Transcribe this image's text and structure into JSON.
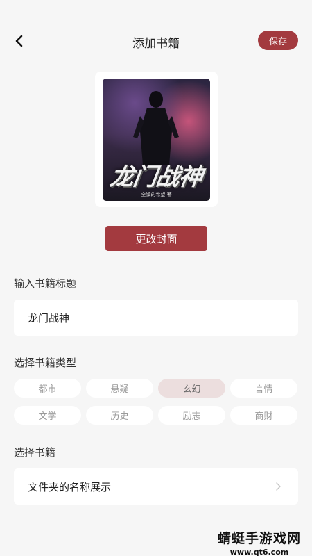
{
  "header": {
    "title": "添加书籍",
    "save_label": "保存"
  },
  "cover": {
    "title_art": "龙门战神",
    "author_art": "全镇的希望 著",
    "change_label": "更改封面"
  },
  "title_section": {
    "label": "输入书籍标题",
    "value": "龙门战神"
  },
  "genre_section": {
    "label": "选择书籍类型",
    "options": [
      "都市",
      "悬疑",
      "玄幻",
      "言情",
      "文学",
      "历史",
      "励志",
      "商财"
    ],
    "selected": "玄幻"
  },
  "book_section": {
    "label": "选择书籍",
    "value": "文件夹的名称展示"
  },
  "watermark": {
    "main": "蜻蜓手游戏网",
    "sub": "www.qt6.com"
  },
  "colors": {
    "accent": "#a33a3f",
    "selected_chip_bg": "#ecdede",
    "background": "#f6f6f6"
  }
}
